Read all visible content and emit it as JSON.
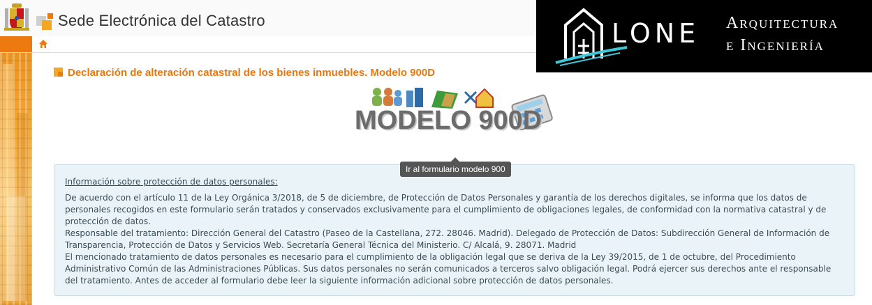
{
  "header": {
    "site_title": "Sede Electrónica del Catastro"
  },
  "brand": {
    "name": "LONE",
    "line1": "Arquitectura",
    "line2": "e Ingeniería"
  },
  "page": {
    "title": "Declaración de alteración catastral de los bienes inmuebles. Modelo 900D",
    "logo_text": "MODELO 900D",
    "tooltip": "Ir al formulario modelo 900"
  },
  "info": {
    "title": "Información sobre protección de datos personales:",
    "paragraphs": [
      "De acuerdo con el artículo 11 de la Ley Orgánica 3/2018, de 5 de diciembre, de Protección de Datos Personales y garantía de los derechos digitales, se informa que los datos de personales recogidos en este formulario serán tratados y conservados exclusivamente para el cumplimiento de obligaciones legales, de conformidad con la normativa catastral y de protección de datos.",
      "Responsable del tratamiento: Dirección General del Catastro (Paseo de la Castellana, 272. 28046. Madrid). Delegado de Protección de Datos: Subdirección General de Información de Transparencia, Protección de Datos y Servicios Web. Secretaría General Técnica del Ministerio. C/ Alcalá, 9. 28071. Madrid",
      "El mencionado tratamiento de datos personales es necesario para el cumplimiento de la obligación legal que se deriva de la Ley 39/2015, de 1 de octubre, del Procedimiento Administrativo Común de las Administraciones Públicas. Sus datos personales no serán comunicados a terceros salvo obligación legal. Podrá ejercer sus derechos ante el responsable del tratamiento. Antes de acceder al formulario debe leer la siguiente información adicional sobre protección de datos personales."
    ]
  },
  "colors": {
    "accent": "#e8770e",
    "nav_orange": "#ec7a10",
    "info_bg": "#eaf4f8"
  },
  "icons": {
    "coat": "spain-coat-of-arms-icon",
    "site": "catastro-logo-icon",
    "home": "home-icon",
    "title": "square-bullet-icon"
  }
}
